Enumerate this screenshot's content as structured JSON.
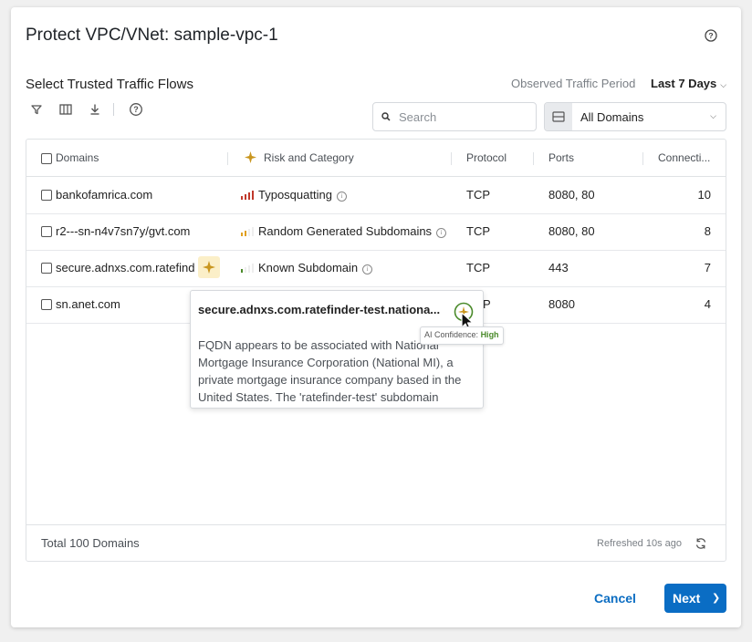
{
  "modal": {
    "title": "Protect VPC/VNet: sample-vpc-1",
    "subtitle": "Select Trusted Traffic Flows",
    "period_label": "Observed Traffic Period",
    "period_value": "Last 7 Days"
  },
  "toolbar": {
    "icons": [
      "filter-icon",
      "columns-icon",
      "download-icon",
      "help-icon"
    ],
    "search_placeholder": "Search",
    "domain_filter": "All Domains"
  },
  "table": {
    "columns": [
      "Domains",
      "Risk and Category",
      "Protocol",
      "Ports",
      "Connecti..."
    ],
    "rows": [
      {
        "domain": "bankofamrica.com",
        "risk": "Typosquatting",
        "risk_level": "high",
        "protocol": "TCP",
        "ports": "8080, 80",
        "connections": "10"
      },
      {
        "domain": "r2---sn-n4v7sn7y/gvt.com",
        "risk": "Random Generated Subdomains",
        "risk_level": "medium",
        "protocol": "TCP",
        "ports": "8080, 80",
        "connections": "8"
      },
      {
        "domain": "secure.adnxs.com.ratefind",
        "risk": "Known Subdomain",
        "risk_level": "low",
        "protocol": "TCP",
        "ports": "443",
        "connections": "7"
      },
      {
        "domain": "sn.anet.com",
        "risk": "",
        "risk_level": "",
        "protocol": "P",
        "ports": "8080",
        "connections": "4"
      }
    ],
    "total": "Total 100 Domains",
    "refreshed": "Refreshed 10s ago"
  },
  "popover": {
    "title": "secure.adnxs.com.ratefinder-test.nationa...",
    "body": "FQDN appears to be associated with National Mortgage Insurance Corporation (National MI), a private mortgage insurance company based in the United States. The 'ratefinder-test' subdomain",
    "confidence_label": "AI Confidence:",
    "confidence_value": "High"
  },
  "footer": {
    "cancel_label": "Cancel",
    "next_label": "Next"
  },
  "colors": {
    "primary": "#0a6dc4",
    "ai_gold": "#c9961f",
    "risk_high": "#c0392b",
    "risk_medium": "#e0a020",
    "risk_low": "#4a8a2a",
    "confidence_high": "#4a8a2a"
  }
}
